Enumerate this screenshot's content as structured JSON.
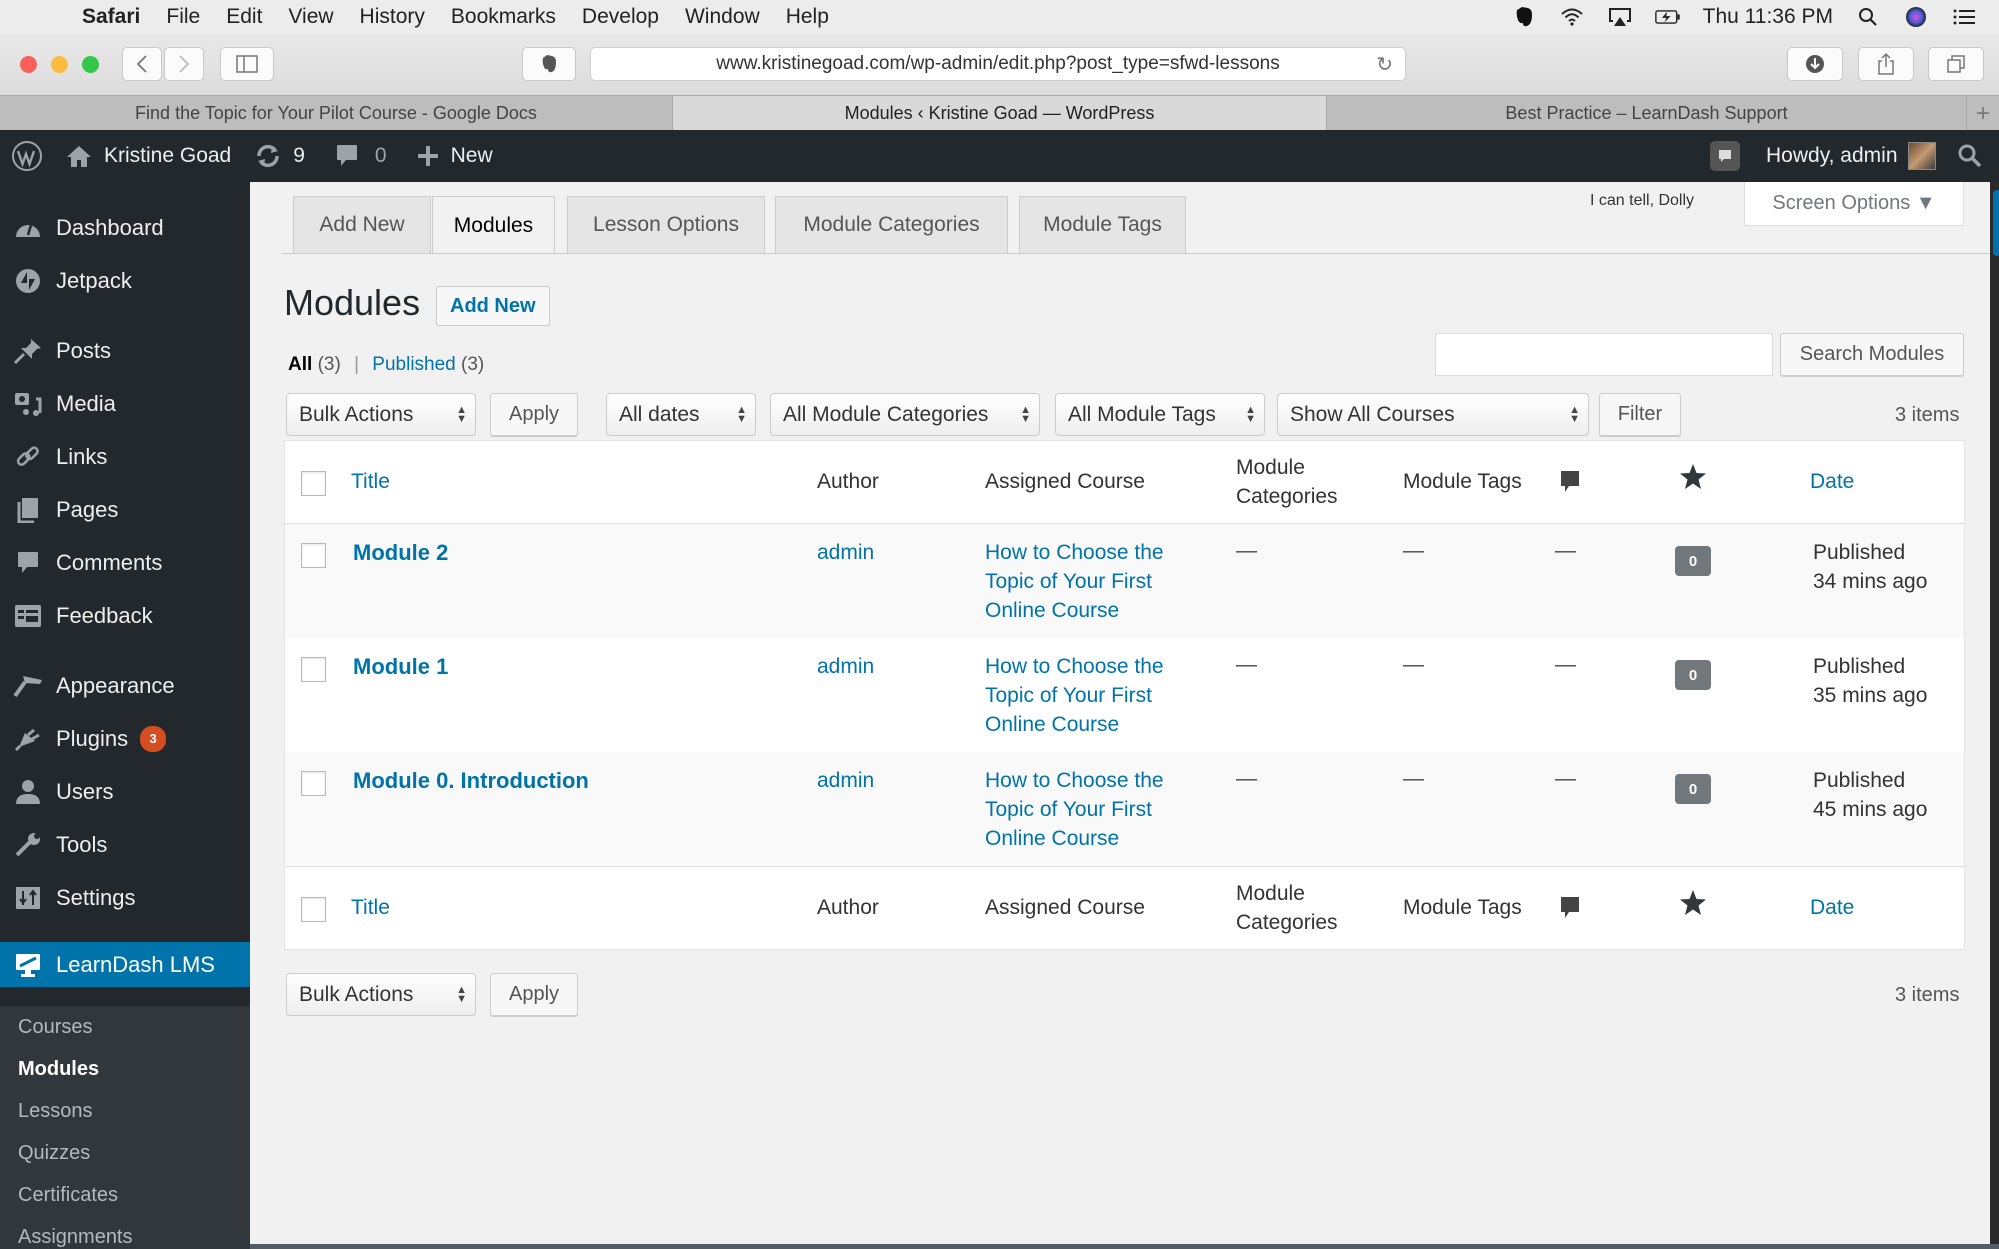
{
  "menubar": {
    "app": "Safari",
    "items": [
      "File",
      "Edit",
      "View",
      "History",
      "Bookmarks",
      "Develop",
      "Window",
      "Help"
    ],
    "clock": "Thu 11:36 PM"
  },
  "browser": {
    "url": "www.kristinegoad.com/wp-admin/edit.php?post_type=sfwd-lessons",
    "tabs": [
      {
        "label": "Find the Topic for Your Pilot Course - Google Docs"
      },
      {
        "label": "Modules ‹ Kristine Goad — WordPress"
      },
      {
        "label": "Best Practice – LearnDash Support"
      }
    ]
  },
  "adminbar": {
    "site_name": "Kristine Goad",
    "updates_count": "9",
    "comments_count": "0",
    "new_label": "New",
    "greeting": "Howdy, admin"
  },
  "sidebar": {
    "items": [
      {
        "label": "Dashboard",
        "icon": "dashboard-icon"
      },
      {
        "label": "Jetpack",
        "icon": "jetpack-icon"
      },
      {
        "label": "Posts",
        "icon": "pushpin-icon"
      },
      {
        "label": "Media",
        "icon": "media-icon"
      },
      {
        "label": "Links",
        "icon": "link-icon"
      },
      {
        "label": "Pages",
        "icon": "pages-icon"
      },
      {
        "label": "Comments",
        "icon": "comment-icon"
      },
      {
        "label": "Feedback",
        "icon": "feedback-icon"
      },
      {
        "label": "Appearance",
        "icon": "paintbrush-icon"
      },
      {
        "label": "Plugins",
        "icon": "plugin-icon",
        "badge": "3"
      },
      {
        "label": "Users",
        "icon": "user-icon"
      },
      {
        "label": "Tools",
        "icon": "wrench-icon"
      },
      {
        "label": "Settings",
        "icon": "settings-icon"
      },
      {
        "label": "LearnDash LMS",
        "icon": "monitor-icon"
      }
    ],
    "submenu": [
      "Courses",
      "Modules",
      "Lessons",
      "Quizzes",
      "Certificates",
      "Assignments"
    ],
    "badge_color": "#d54e21",
    "accent_color": "#0073aa"
  },
  "page": {
    "nav_tabs": [
      "Add New",
      "Modules",
      "Lesson Options",
      "Module Categories",
      "Module Tags"
    ],
    "dolly": "I can tell, Dolly",
    "screen_options": "Screen Options ▼",
    "title": "Modules",
    "add_new": "Add New",
    "views": {
      "all": "All",
      "all_count": "(3)",
      "sep": "|",
      "published": "Published",
      "published_count": "(3)"
    },
    "search_placeholder": "",
    "search_button": "Search Modules",
    "bulk_actions": "Bulk Actions",
    "apply": "Apply",
    "dates_filter": "All dates",
    "categories_filter": "All Module Categories",
    "tags_filter": "All Module Tags",
    "courses_filter": "Show All Courses",
    "filter_button": "Filter",
    "item_count": "3 items"
  },
  "table": {
    "columns": {
      "title": "Title",
      "author": "Author",
      "course": "Assigned Course",
      "categories": "Module Categories",
      "tags": "Module Tags",
      "date": "Date"
    },
    "rows": [
      {
        "title": "Module 2",
        "author": "admin",
        "course": "How to Choose the Topic of Your First Online Course",
        "categories": "—",
        "tags": "—",
        "comments": "—",
        "stars": "0",
        "status": "Published",
        "date": "34 mins ago"
      },
      {
        "title": "Module 1",
        "author": "admin",
        "course": "How to Choose the Topic of Your First Online Course",
        "categories": "—",
        "tags": "—",
        "comments": "—",
        "stars": "0",
        "status": "Published",
        "date": "35 mins ago"
      },
      {
        "title": "Module 0. Introduction",
        "author": "admin",
        "course": "How to Choose the Topic of Your First Online Course",
        "categories": "—",
        "tags": "—",
        "comments": "—",
        "stars": "0",
        "status": "Published",
        "date": "45 mins ago"
      }
    ]
  }
}
